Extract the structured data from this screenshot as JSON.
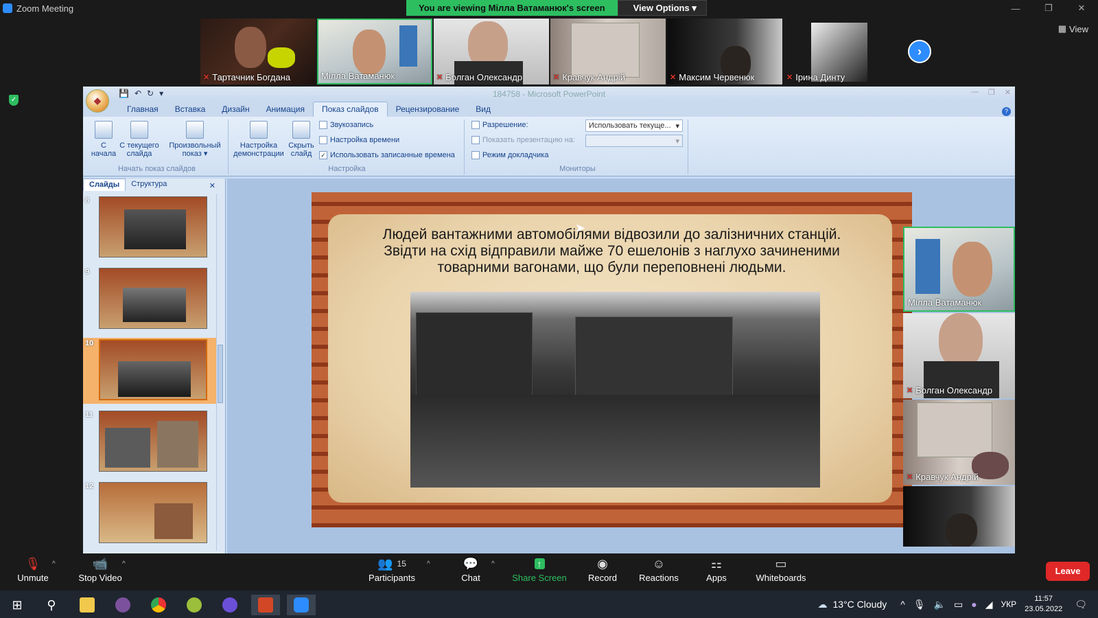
{
  "zoom": {
    "window_title": "Zoom Meeting",
    "share_banner": "You are viewing Мілла Ватаманюк's screen",
    "view_options": "View Options",
    "view_label": "View"
  },
  "participants_strip": [
    {
      "name": "Тартачник Богдана",
      "muted": true
    },
    {
      "name": "Мілла Ватаманюк",
      "muted": false
    },
    {
      "name": "Болган Олександр",
      "muted": true
    },
    {
      "name": "Кравчук Андрій",
      "muted": true
    },
    {
      "name": "Максим Червенюк",
      "muted": true
    },
    {
      "name": "Ірина Динту",
      "muted": true
    }
  ],
  "side_tiles": [
    {
      "name": "Мілла Ватаманюк",
      "muted": false
    },
    {
      "name": "Болган Олександр",
      "muted": true
    },
    {
      "name": "Кравчук Андрій",
      "muted": true
    },
    {
      "name": "",
      "muted": false
    }
  ],
  "ppt": {
    "doc_title": "184758 - Microsoft PowerPoint",
    "tabs": [
      "Главная",
      "Вставка",
      "Дизайн",
      "Анимация",
      "Показ слайдов",
      "Рецензирование",
      "Вид"
    ],
    "active_tab": "Показ слайдов",
    "groups": {
      "start": {
        "label": "Начать показ слайдов",
        "btn_from_start": "С начала",
        "btn_from_current": "С текущего слайда",
        "btn_custom": "Произвольный показ"
      },
      "setup": {
        "label": "Настройка",
        "btn_setup": "Настройка демонстрации",
        "btn_hide": "Скрыть слайд",
        "record": "Звукозапись",
        "rehearse": "Настройка времени",
        "use_timings": "Использовать записанные времена"
      },
      "monitors": {
        "label": "Мониторы",
        "resolution": "Разрешение:",
        "resolution_value": "Использовать текуще...",
        "show_on": "Показать презентацию на:",
        "presenter": "Режим докладчика"
      }
    },
    "panel_tabs": [
      "Слайды",
      "Структура"
    ],
    "thumbnails": [
      {
        "num": "8",
        "selected": false
      },
      {
        "num": "9",
        "selected": false
      },
      {
        "num": "10",
        "selected": true
      },
      {
        "num": "11",
        "selected": false
      },
      {
        "num": "12",
        "selected": false
      }
    ],
    "slide_text": "Людей вантажними автомобілями відвозили до залізничних станцій. Звідти на схід відправили майже 70 ешелонів з наглухо зачиненими товарними вагонами, що були переповнені людьми."
  },
  "toolbar": {
    "unmute": "Unmute",
    "stop_video": "Stop Video",
    "participants": "Participants",
    "participants_count": "15",
    "chat": "Chat",
    "share_screen": "Share Screen",
    "record": "Record",
    "reactions": "Reactions",
    "apps": "Apps",
    "whiteboards": "Whiteboards",
    "leave": "Leave"
  },
  "taskbar": {
    "weather": "13°C  Cloudy",
    "lang": "УКР",
    "time": "11:57",
    "date": "23.05.2022"
  }
}
